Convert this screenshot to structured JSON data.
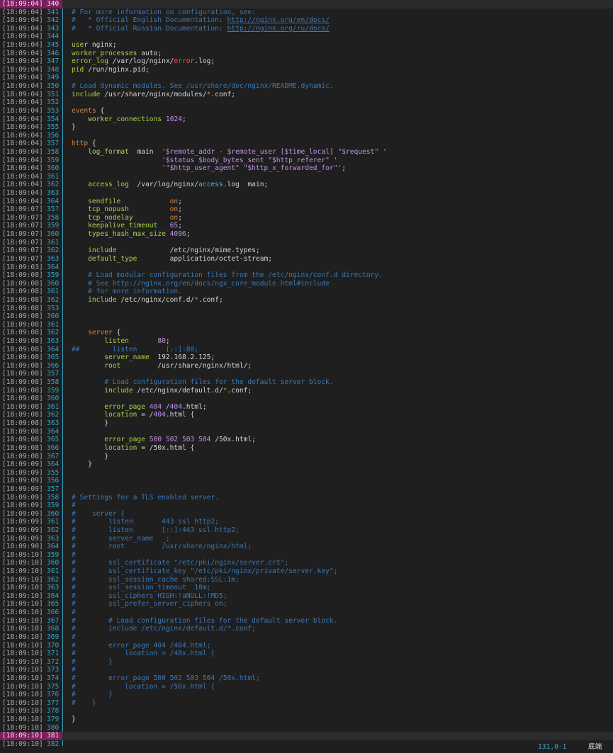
{
  "editor": {
    "lines": [
      {
        "ts": "[18:09:04]",
        "ln": "340",
        "code": "",
        "current": true
      },
      {
        "ts": "[18:09:04]",
        "ln": "341",
        "code": "# For more information on configuration, see:"
      },
      {
        "ts": "[18:09:04]",
        "ln": "342",
        "code": "#   * Official English Documentation: http://nginx.org/en/docs/"
      },
      {
        "ts": "[18:09:04]",
        "ln": "343",
        "code": "#   * Official Russian Documentation: http://nginx.org/ru/docs/"
      },
      {
        "ts": "[18:09:04]",
        "ln": "344",
        "code": ""
      },
      {
        "ts": "[18:09:04]",
        "ln": "345",
        "code": "user nginx;"
      },
      {
        "ts": "[18:09:04]",
        "ln": "346",
        "code": "worker_processes auto;"
      },
      {
        "ts": "[18:09:04]",
        "ln": "347",
        "code": "error_log /var/log/nginx/error.log;"
      },
      {
        "ts": "[18:09:04]",
        "ln": "348",
        "code": "pid /run/nginx.pid;"
      },
      {
        "ts": "[18:09:04]",
        "ln": "349",
        "code": ""
      },
      {
        "ts": "[18:09:04]",
        "ln": "350",
        "code": "# Load dynamic modules. See /usr/share/doc/nginx/README.dynamic."
      },
      {
        "ts": "[18:09:04]",
        "ln": "351",
        "code": "include /usr/share/nginx/modules/*.conf;"
      },
      {
        "ts": "[18:09:04]",
        "ln": "352",
        "code": ""
      },
      {
        "ts": "[18:09:04]",
        "ln": "353",
        "code": "events {"
      },
      {
        "ts": "[18:09:04]",
        "ln": "354",
        "code": "    worker_connections 1024;"
      },
      {
        "ts": "[18:09:04]",
        "ln": "355",
        "code": "}"
      },
      {
        "ts": "[18:09:04]",
        "ln": "356",
        "code": ""
      },
      {
        "ts": "[18:09:04]",
        "ln": "357",
        "code": "http {"
      },
      {
        "ts": "[18:09:04]",
        "ln": "358",
        "code": "    log_format  main  '$remote_addr - $remote_user [$time_local] \"$request\" '"
      },
      {
        "ts": "[18:09:04]",
        "ln": "359",
        "code": "                      '$status $body_bytes_sent \"$http_referer\" '"
      },
      {
        "ts": "[18:09:04]",
        "ln": "360",
        "code": "                      '\"$http_user_agent\" \"$http_x_forwarded_for\"';"
      },
      {
        "ts": "[18:09:04]",
        "ln": "361",
        "code": ""
      },
      {
        "ts": "[18:09:04]",
        "ln": "362",
        "code": "    access_log  /var/log/nginx/access.log  main;"
      },
      {
        "ts": "[18:09:04]",
        "ln": "363",
        "code": ""
      },
      {
        "ts": "[18:09:04]",
        "ln": "364",
        "code": "    sendfile            on;"
      },
      {
        "ts": "[18:09:0?]",
        "ln": "35?",
        "code": "    tcp_nopush          on;"
      },
      {
        "ts": "[18:09:07]",
        "ln": "358",
        "code": "    tcp_nodelay         on;"
      },
      {
        "ts": "[18:09:07]",
        "ln": "359",
        "code": "    keepalive_timeout   65;"
      },
      {
        "ts": "[18:09:07]",
        "ln": "360",
        "code": "    types_hash_max_size 4096;"
      },
      {
        "ts": "[18:09:07]",
        "ln": "361",
        "code": ""
      },
      {
        "ts": "[18:09:07]",
        "ln": "362",
        "code": "    include             /etc/nginx/mime.types;"
      },
      {
        "ts": "[18:09:07]",
        "ln": "363",
        "code": "    default_type        application/octet-stream;"
      },
      {
        "ts": "[18:09:03]",
        "ln": "364",
        "code": ""
      },
      {
        "ts": "[18:09:08]",
        "ln": "359",
        "code": "    # Load modular configuration files from the /etc/nginx/conf.d directory."
      },
      {
        "ts": "[18:09:08]",
        "ln": "360",
        "code": "    # See http://nginx.org/en/docs/ngx_core_module.html#include"
      },
      {
        "ts": "[18:09:08]",
        "ln": "361",
        "code": "    # for more information."
      },
      {
        "ts": "[18:09:08]",
        "ln": "362",
        "code": "    include /etc/nginx/conf.d/*.conf;"
      },
      {
        "ts": "[18:09:08]",
        "ln": "353",
        "code": ""
      },
      {
        "ts": "[18:09:08]",
        "ln": "360",
        "code": ""
      },
      {
        "ts": "[18:09:08]",
        "ln": "361",
        "code": ""
      },
      {
        "ts": "[18:09:08]",
        "ln": "362",
        "code": "    server {"
      },
      {
        "ts": "[18:09:08]",
        "ln": "363",
        "code": "        listen       80;"
      },
      {
        "ts": "[18:09:08]",
        "ln": "364",
        "code": "##        listen       [::]:80;"
      },
      {
        "ts": "[18:09:08]",
        "ln": "365",
        "code": "        server_name  192.168.2.125;"
      },
      {
        "ts": "[18:09:08]",
        "ln": "366",
        "code": "        root         /usr/share/nginx/html/;"
      },
      {
        "ts": "[18:09:08]",
        "ln": "357",
        "code": ""
      },
      {
        "ts": "[18:09:08]",
        "ln": "358",
        "code": "        # Load configuration files for the default server block."
      },
      {
        "ts": "[18:09:08]",
        "ln": "359",
        "code": "        include /etc/nginx/default.d/*.conf;"
      },
      {
        "ts": "[18:09:08]",
        "ln": "360",
        "code": ""
      },
      {
        "ts": "[18:09:08]",
        "ln": "361",
        "code": "        error_page 404 /404.html;"
      },
      {
        "ts": "[18:09:08]",
        "ln": "362",
        "code": "        location = /404.html {"
      },
      {
        "ts": "[18:09:08]",
        "ln": "363",
        "code": "        }"
      },
      {
        "ts": "[18:09:08]",
        "ln": "364",
        "code": ""
      },
      {
        "ts": "[18:09:08]",
        "ln": "365",
        "code": "        error_page 500 502 503 504 /50x.html;"
      },
      {
        "ts": "[18:09:08]",
        "ln": "366",
        "code": "        location = /50x.html {"
      },
      {
        "ts": "[18:09:08]",
        "ln": "367",
        "code": "        }"
      },
      {
        "ts": "[18:09:09]",
        "ln": "364",
        "code": "    }"
      },
      {
        "ts": "[18:09:09]",
        "ln": "355",
        "code": ""
      },
      {
        "ts": "[18:09:09]",
        "ln": "356",
        "code": ""
      },
      {
        "ts": "[18:09:09]",
        "ln": "357",
        "code": ""
      },
      {
        "ts": "[18:09:09]",
        "ln": "358",
        "code": "# Settings for a TLS enabled server."
      },
      {
        "ts": "[18:09:09]",
        "ln": "359",
        "code": "#"
      },
      {
        "ts": "[18:09:09]",
        "ln": "360",
        "code": "#    server {"
      },
      {
        "ts": "[18:09:09]",
        "ln": "361",
        "code": "#        listen       443 ssl http2;"
      },
      {
        "ts": "[18:09:09]",
        "ln": "362",
        "code": "#        listen       [::]:443 ssl http2;"
      },
      {
        "ts": "[18:09:09]",
        "ln": "363",
        "code": "#        server_name  _;"
      },
      {
        "ts": "[18:09:90]",
        "ln": "364",
        "code": "#        root         /usr/share/nginx/html;"
      },
      {
        "ts": "[18:09:10]",
        "ln": "359",
        "code": "#"
      },
      {
        "ts": "[18:09:10]",
        "ln": "360",
        "code": "#        ssl_certificate \"/etc/pki/nginx/server.crt\";"
      },
      {
        "ts": "[18:09:10]",
        "ln": "361",
        "code": "#        ssl_certificate_key \"/etc/pki/nginx/private/server.key\";"
      },
      {
        "ts": "[18:09:10]",
        "ln": "362",
        "code": "#        ssl_session_cache shared:SSL:1m;"
      },
      {
        "ts": "[18:09:10]",
        "ln": "363",
        "code": "#        ssl_session_timeout  10m;"
      },
      {
        "ts": "[18:09:10]",
        "ln": "364",
        "code": "#        ssl_ciphers HIGH:!aNULL:!MD5;"
      },
      {
        "ts": "[18:09:10]",
        "ln": "365",
        "code": "#        ssl_prefer_server_ciphers on;"
      },
      {
        "ts": "[18:09:10]",
        "ln": "366",
        "code": "#"
      },
      {
        "ts": "[18:09:10]",
        "ln": "367",
        "code": "#        # Load configuration files for the default server block."
      },
      {
        "ts": "[18:09:10]",
        "ln": "368",
        "code": "#        include /etc/nginx/default.d/*.conf;"
      },
      {
        "ts": "[18:09:10]",
        "ln": "369",
        "code": "#"
      },
      {
        "ts": "[18:09:10]",
        "ln": "370",
        "code": "#        error_page 404 /404.html;"
      },
      {
        "ts": "[18:09:10]",
        "ln": "371",
        "code": "#            location = /40x.html {"
      },
      {
        "ts": "[18:09:10]",
        "ln": "372",
        "code": "#        }"
      },
      {
        "ts": "[18:09:10]",
        "ln": "373",
        "code": "#"
      },
      {
        "ts": "[18:09:10]",
        "ln": "374",
        "code": "#        error_page 500 502 503 504 /50x.html;"
      },
      {
        "ts": "[18:09:10]",
        "ln": "375",
        "code": "#            location = /50x.html {"
      },
      {
        "ts": "[18:09:10]",
        "ln": "376",
        "code": "#        }"
      },
      {
        "ts": "[18:09:10]",
        "ln": "377",
        "code": "#    }"
      },
      {
        "ts": "[18:09:10]",
        "ln": "378",
        "code": ""
      },
      {
        "ts": "[18:09:10]",
        "ln": "379",
        "code": "}"
      },
      {
        "ts": "[18:09:10]",
        "ln": "380",
        "code": ""
      },
      {
        "ts": "[18:09:10]",
        "ln": "381",
        "code": "",
        "current": true
      },
      {
        "ts": "[18:09:10]",
        "ln": "382",
        "code": ""
      }
    ]
  },
  "statusbar": {
    "position": "131,0-1",
    "scroll": "底端"
  },
  "colors": {
    "background": "#1f1f1f",
    "comment": "#3b78b5",
    "keyword": "#d2863a",
    "directive": "#a9d34e",
    "number": "#c191ea",
    "line_number": "#2fa7c9",
    "timestamp_highlight": "#7a1f5c"
  }
}
